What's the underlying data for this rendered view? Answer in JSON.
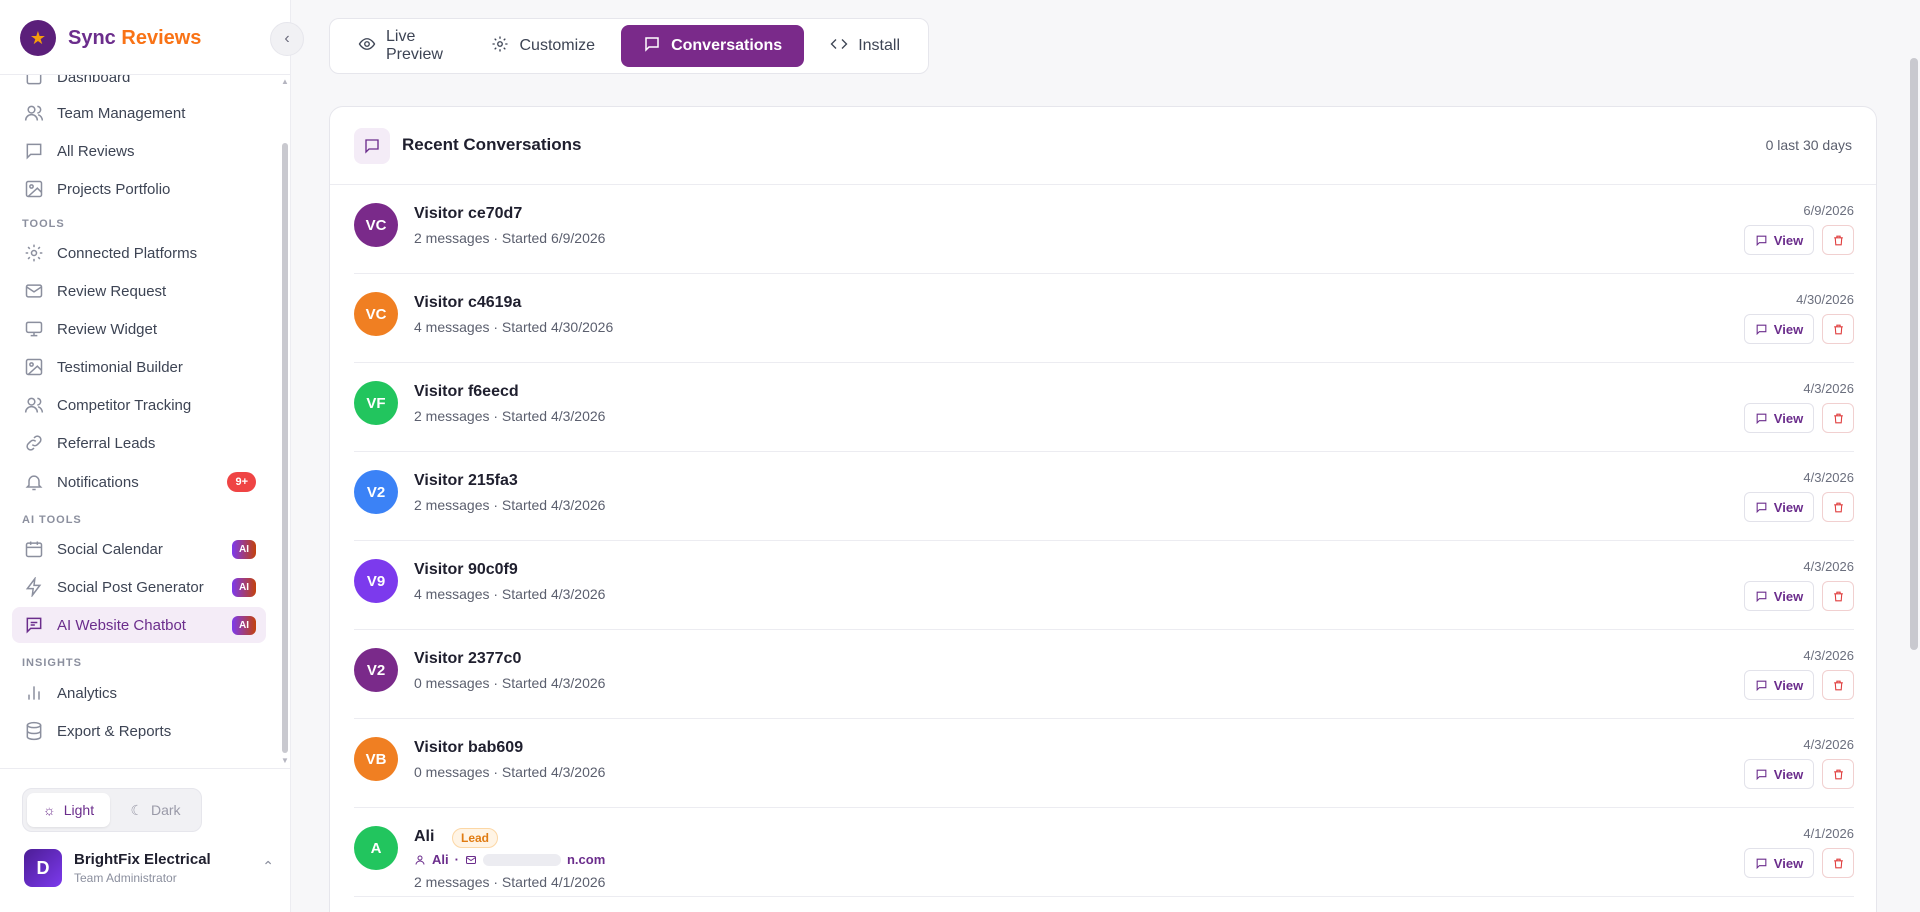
{
  "brand": {
    "name_primary": "Sync",
    "name_accent": "Reviews"
  },
  "sidebar": {
    "items": [
      {
        "label": "Dashboard"
      },
      {
        "label": "Team Management"
      },
      {
        "label": "All Reviews"
      },
      {
        "label": "Projects Portfolio"
      },
      {
        "label": "Connected Platforms"
      },
      {
        "label": "Review Request"
      },
      {
        "label": "Review Widget"
      },
      {
        "label": "Testimonial Builder"
      },
      {
        "label": "Competitor Tracking"
      },
      {
        "label": "Referral Leads"
      },
      {
        "label": "Notifications",
        "badge": "9+"
      },
      {
        "label": "Social Calendar",
        "badge": "AI"
      },
      {
        "label": "Social Post Generator",
        "badge": "AI"
      },
      {
        "label": "AI Website Chatbot",
        "badge": "AI"
      },
      {
        "label": "Analytics"
      },
      {
        "label": "Export & Reports"
      }
    ],
    "sections": {
      "tools": "TOOLS",
      "ai_tools": "AI TOOLS",
      "insights": "INSIGHTS"
    },
    "theme": {
      "light": "Light",
      "dark": "Dark"
    },
    "account": {
      "initial": "D",
      "name": "BrightFix Electrical",
      "role": "Team Administrator"
    }
  },
  "tabs": [
    {
      "label": "Live Preview"
    },
    {
      "label": "Customize"
    },
    {
      "label": "Conversations"
    },
    {
      "label": "Install"
    }
  ],
  "panel": {
    "title": "Recent Conversations",
    "meta": "0 last 30 days",
    "view_label": "View",
    "conversations": [
      {
        "initials": "VC",
        "color": "#7a2a8a",
        "name": "Visitor ce70d7",
        "sub": "2 messages · Started 6/9/2026",
        "date": "6/9/2026"
      },
      {
        "initials": "VC",
        "color": "#f07f22",
        "name": "Visitor c4619a",
        "sub": "4 messages · Started 4/30/2026",
        "date": "4/30/2026"
      },
      {
        "initials": "VF",
        "color": "#22c55e",
        "name": "Visitor f6eecd",
        "sub": "2 messages · Started 4/3/2026",
        "date": "4/3/2026"
      },
      {
        "initials": "V2",
        "color": "#3b82f6",
        "name": "Visitor 215fa3",
        "sub": "2 messages · Started 4/3/2026",
        "date": "4/3/2026"
      },
      {
        "initials": "V9",
        "color": "#7c3aed",
        "name": "Visitor 90c0f9",
        "sub": "4 messages · Started 4/3/2026",
        "date": "4/3/2026"
      },
      {
        "initials": "V2",
        "color": "#7a2a8a",
        "name": "Visitor 2377c0",
        "sub": "0 messages · Started 4/3/2026",
        "date": "4/3/2026"
      },
      {
        "initials": "VB",
        "color": "#f07f22",
        "name": "Visitor bab609",
        "sub": "0 messages · Started 4/3/2026",
        "date": "4/3/2026"
      },
      {
        "initials": "A",
        "color": "#22c55e",
        "name": "Ali",
        "lead": "Lead",
        "lead_name": "Ali",
        "lead_email_suffix": "n.com",
        "sub": "2 messages · Started 4/1/2026",
        "date": "4/1/2026"
      }
    ]
  }
}
